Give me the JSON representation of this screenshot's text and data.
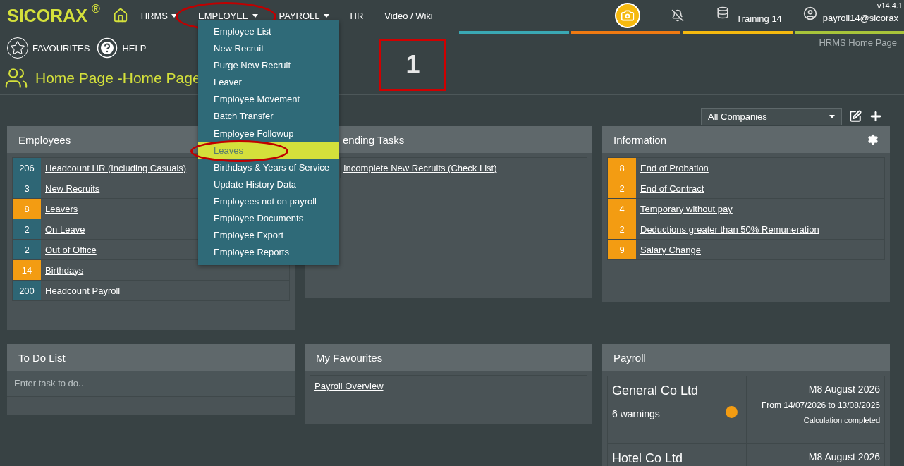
{
  "topbar": {
    "logo": "SICORAX",
    "logo_mark": "®",
    "version": "v14.4.1",
    "nav": [
      {
        "label": "HRMS",
        "has_menu": true,
        "circled": false
      },
      {
        "label": "EMPLOYEE",
        "has_menu": true,
        "circled": true
      },
      {
        "label": "PAYROLL",
        "has_menu": true,
        "circled": false
      },
      {
        "label": "HR",
        "has_menu": false,
        "circled": false
      },
      {
        "label": "Video / Wiki",
        "has_menu": false,
        "circled": false
      }
    ],
    "database": "Training 14",
    "user": "payroll14@sicorax"
  },
  "menu": [
    {
      "label": "Employee List",
      "selected": false,
      "circled": false
    },
    {
      "label": "New Recruit",
      "selected": false,
      "circled": false
    },
    {
      "label": "Purge New Recruit",
      "selected": false,
      "circled": false
    },
    {
      "label": "Leaver",
      "selected": false,
      "circled": false
    },
    {
      "label": "Employee Movement",
      "selected": false,
      "circled": false
    },
    {
      "label": "Batch Transfer",
      "selected": false,
      "circled": false
    },
    {
      "label": "Employee Followup",
      "selected": false,
      "circled": false
    },
    {
      "label": "Leaves",
      "selected": true,
      "circled": true
    },
    {
      "label": "Birthdays & Years of Service",
      "selected": false,
      "circled": false
    },
    {
      "label": "Update History Data",
      "selected": false,
      "circled": false
    },
    {
      "label": "Employees not on payroll",
      "selected": false,
      "circled": false
    },
    {
      "label": "Employee Documents",
      "selected": false,
      "circled": false
    },
    {
      "label": "Employee Export",
      "selected": false,
      "circled": false
    },
    {
      "label": "Employee Reports",
      "selected": false,
      "circled": false
    }
  ],
  "toolbar": {
    "favourites": "FAVOURITES",
    "help": "HELP",
    "breadcrumb": "HRMS Home Page"
  },
  "page_title": "Home Page -Home Page",
  "annotation": "1",
  "company_select": "All Companies",
  "employees": {
    "title": "Employees",
    "rows": [
      {
        "count": "206",
        "label": "Headcount HR (Including Casuals)",
        "link": true,
        "color": "#2e6675"
      },
      {
        "count": "3",
        "label": "New Recruits",
        "link": true,
        "color": "#2e6675"
      },
      {
        "count": "8",
        "label": "Leavers",
        "link": true,
        "color": "#f39c12"
      },
      {
        "count": "2",
        "label": "On Leave",
        "link": true,
        "color": "#2e6675"
      },
      {
        "count": "2",
        "label": "Out of Office",
        "link": true,
        "color": "#2e6675"
      },
      {
        "count": "14",
        "label": "Birthdays",
        "link": true,
        "color": "#f39c12"
      },
      {
        "count": "200",
        "label": "Headcount Payroll",
        "link": false,
        "color": "#2e6675"
      }
    ]
  },
  "pending": {
    "title": "ending Tasks",
    "rows": [
      {
        "label": "Incomplete New Recruits (Check List)"
      }
    ]
  },
  "information": {
    "title": "Information",
    "rows": [
      {
        "count": "8",
        "label": "End of Probation",
        "color": "#f39c12"
      },
      {
        "count": "2",
        "label": "End of Contract",
        "color": "#f39c12"
      },
      {
        "count": "4",
        "label": "Temporary without pay",
        "color": "#f39c12"
      },
      {
        "count": "2",
        "label": "Deductions greater than 50% Remuneration",
        "color": "#f39c12"
      },
      {
        "count": "9",
        "label": "Salary Change",
        "color": "#f39c12"
      }
    ]
  },
  "todo": {
    "title": "To Do List",
    "placeholder": "Enter task to do.."
  },
  "favourites": {
    "title": "My Favourites",
    "links": [
      "Payroll Overview"
    ]
  },
  "payroll": {
    "title": "Payroll",
    "companies": [
      {
        "name": "General Co Ltd",
        "warnings": "6 warnings",
        "color": "#f39c12",
        "period": "M8 August 2026",
        "range": "From 14/07/2026 to 13/08/2026",
        "status": "Calculation completed"
      },
      {
        "name": "Hotel Co Ltd",
        "period": "M8 August 2026"
      }
    ]
  }
}
